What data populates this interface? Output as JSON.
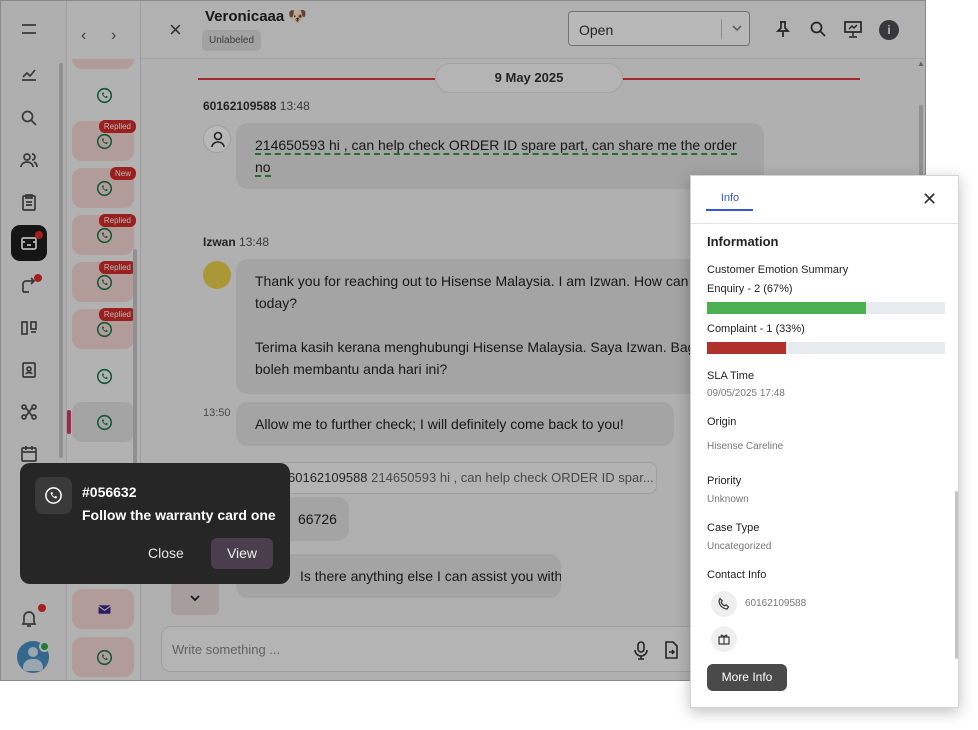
{
  "header": {
    "contact_name": "Veronicaaa 🐶",
    "label_tag": "Unlabeled",
    "status_select": "Open"
  },
  "conversation_list": {
    "items": [
      {
        "badge": ""
      },
      {
        "badge": "Replied"
      },
      {
        "badge": "New"
      },
      {
        "badge": "Replied"
      },
      {
        "badge": "Replied"
      },
      {
        "badge": "Replied"
      },
      {
        "badge": ""
      },
      {
        "badge": ""
      },
      {
        "badge": ""
      },
      {
        "badge": ""
      }
    ]
  },
  "chat": {
    "date_divider": "9 May 2025",
    "messages": [
      {
        "sender": "60162109588",
        "time": "13:48",
        "text": "214650593 hi , can help check ORDER ID spare part, can share me the order no"
      },
      {
        "sender": "Izwan",
        "time": "13:48",
        "text_en": "Thank you for reaching out to Hisense Malaysia. I am Izwan. How can I assist you today?",
        "text_ms": "Terima kasih kerana menghubungi Hisense Malaysia. Saya Izwan. Bagaimana saya boleh membantu anda hari ini?"
      },
      {
        "time": "13:50",
        "text": "Allow me to further check; I will definitely come back to you!"
      },
      {
        "quote_sender": "60162109588",
        "quote_text": "214650593 hi , can help check ORDER ID spar...",
        "text": "66726"
      },
      {
        "text": "Is there anything else I can assist you with?"
      }
    ],
    "composer_placeholder": "Write something ..."
  },
  "toast": {
    "ticket_id": "#056632",
    "message": "Follow the warranty card one",
    "close_label": "Close",
    "view_label": "View"
  },
  "info_panel": {
    "tab": "Info",
    "heading": "Information",
    "emotion_title": "Customer Emotion Summary",
    "emotions": [
      {
        "label": "Enquiry - 2 (67%)",
        "percent": 67,
        "color": "#4caf50"
      },
      {
        "label": "Complaint - 1 (33%)",
        "percent": 33,
        "color": "#b0302a"
      }
    ],
    "sla_label": "SLA Time",
    "sla_value": "09/05/2025 17:48",
    "origin_label": "Origin",
    "origin_value": "Hisense Careline",
    "priority_label": "Priority",
    "priority_value": "Unknown",
    "case_type_label": "Case Type",
    "case_type_value": "Uncategorized",
    "contact_label": "Contact Info",
    "phone_value": "60162109588",
    "more_info_label": "More Info"
  },
  "colors": {
    "accent_blue": "#3557d6",
    "badge_red": "#d62c2c",
    "date_line_red": "#e03a3a"
  }
}
